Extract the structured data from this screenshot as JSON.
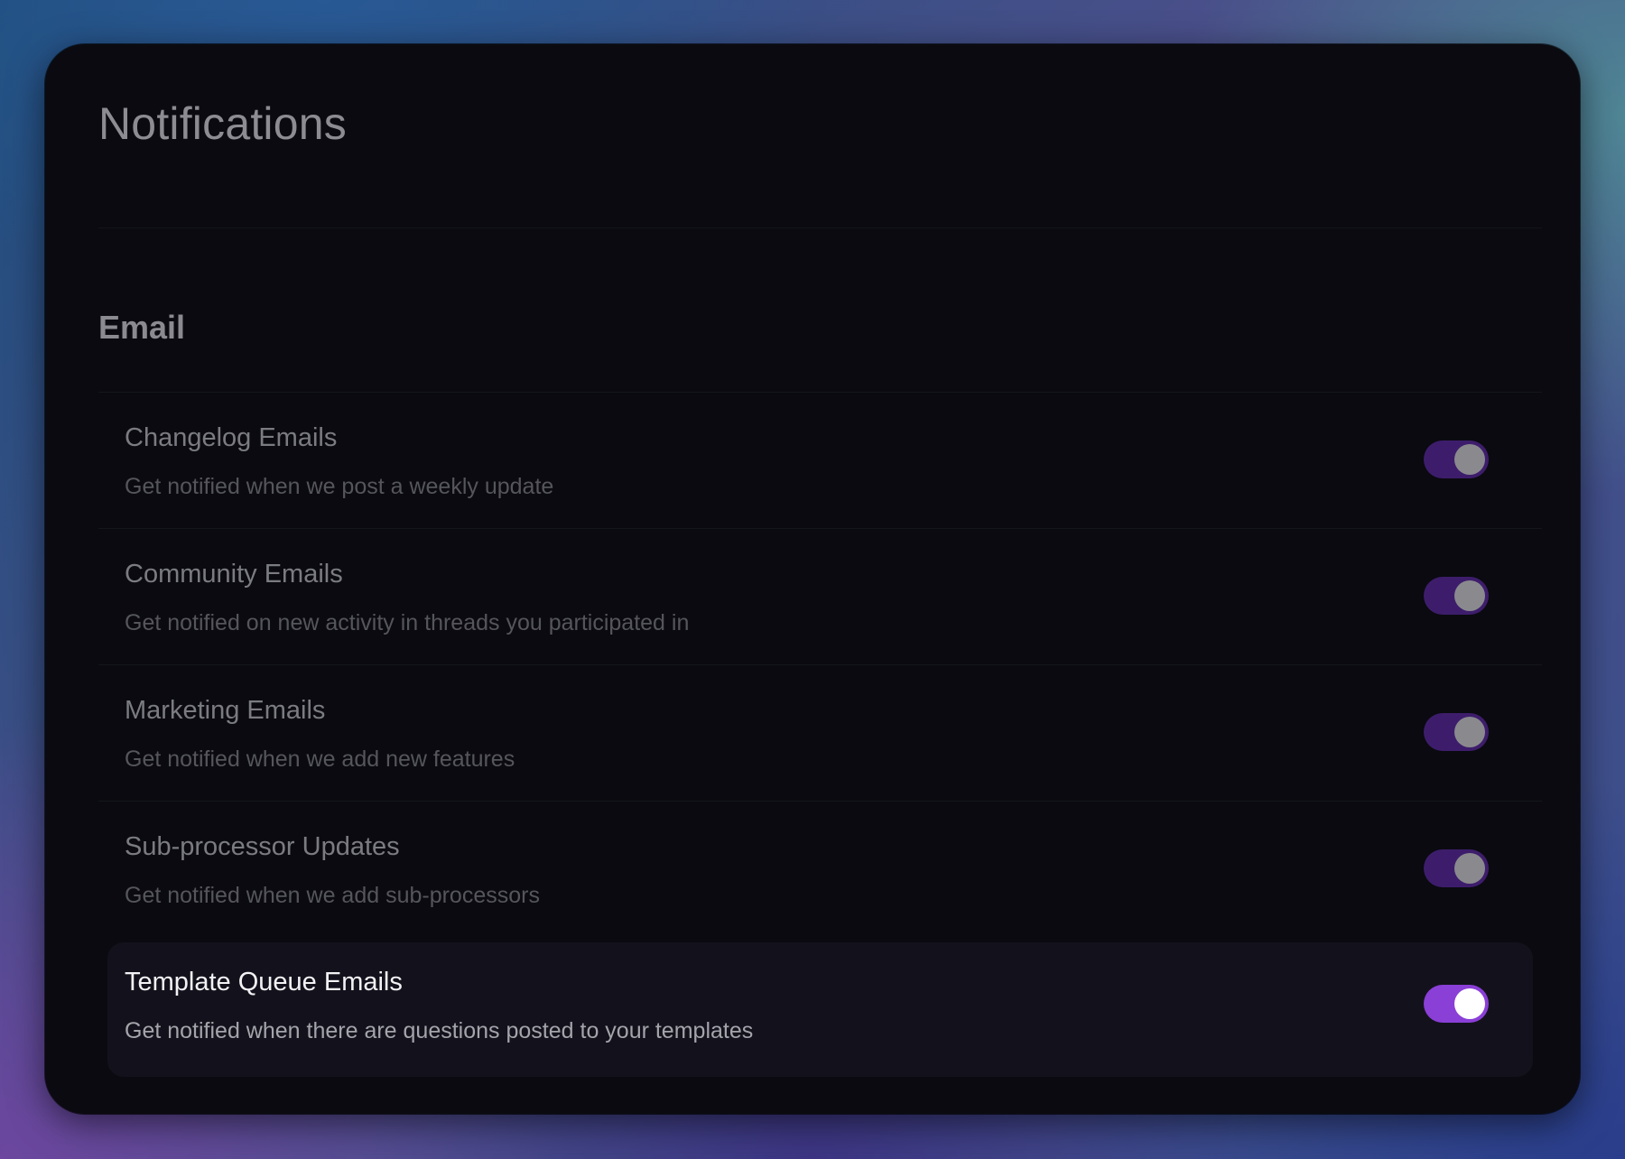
{
  "page": {
    "title": "Notifications"
  },
  "email_section": {
    "title": "Email",
    "items": [
      {
        "title": "Changelog Emails",
        "description": "Get notified when we post a weekly update",
        "enabled": true
      },
      {
        "title": "Community Emails",
        "description": "Get notified on new activity in threads you participated in",
        "enabled": true
      },
      {
        "title": "Marketing Emails",
        "description": "Get notified when we add new features",
        "enabled": true
      },
      {
        "title": "Sub-processor Updates",
        "description": "Get notified when we add sub-processors",
        "enabled": true
      },
      {
        "title": "Template Queue Emails",
        "description": "Get notified when there are questions posted to your templates",
        "enabled": true
      }
    ]
  },
  "colors": {
    "toggle_on_active": "#8a3fd6",
    "toggle_on_dimmed": "#3d1d6b",
    "card_background": "#0a0a10"
  }
}
